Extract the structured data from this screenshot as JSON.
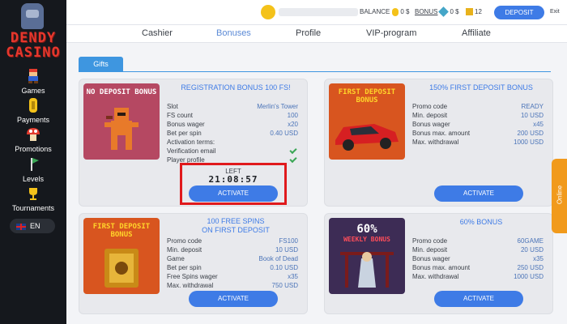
{
  "sidebar": {
    "logo_line1": "DENDY",
    "logo_line2": "CASINO",
    "items": [
      {
        "label": "Games"
      },
      {
        "label": "Payments"
      },
      {
        "label": "Promotions"
      },
      {
        "label": "Levels"
      },
      {
        "label": "Tournaments"
      }
    ],
    "language": "EN"
  },
  "header": {
    "balance_label": "BALANCE",
    "balance_value": "0",
    "balance_currency": "$",
    "bonus_label": "BONUS",
    "bonus_value": "0",
    "bonus_currency": "$",
    "gifts_count": "12",
    "deposit_label": "DEPOSIT",
    "exit_label": "Exit"
  },
  "tabs": [
    "Cashier",
    "Bonuses",
    "Profile",
    "VIP-program",
    "Affiliate"
  ],
  "active_tab": "Bonuses",
  "subtab": "Gifts",
  "cards": [
    {
      "image_label": "NO DEPOSIT BONUS",
      "title": "REGISTRATION BONUS 100 FS!",
      "rows": [
        {
          "k": "Slot",
          "v": "Merlin's Tower"
        },
        {
          "k": "FS count",
          "v": "100"
        },
        {
          "k": "Bonus wager",
          "v": "x20"
        },
        {
          "k": "Bet per spin",
          "v": "0.40 USD"
        },
        {
          "k": "Activation terms:",
          "v": ""
        },
        {
          "k": "Verification email",
          "v": ""
        },
        {
          "k": "Player profile",
          "v": ""
        }
      ],
      "timer_label": "LEFT",
      "timer_value": "21:08:57",
      "button": "ACTIVATE"
    },
    {
      "image_label": "FIRST DEPOSIT BONUS",
      "title": "150% FIRST DEPOSIT BONUS",
      "rows": [
        {
          "k": "Promo code",
          "v": "READY"
        },
        {
          "k": "Min. deposit",
          "v": "10 USD"
        },
        {
          "k": "Bonus wager",
          "v": "x45"
        },
        {
          "k": "Bonus max. amount",
          "v": "200 USD"
        },
        {
          "k": "Max. withdrawal",
          "v": "1000 USD"
        }
      ],
      "button": "ACTIVATE"
    },
    {
      "image_label": "FIRST DEPOSIT BONUS",
      "title_line1": "100 FREE SPINS",
      "title_line2": "ON FIRST DEPOSIT",
      "rows": [
        {
          "k": "Promo code",
          "v": "FS100"
        },
        {
          "k": "Min. deposit",
          "v": "10 USD"
        },
        {
          "k": "Game",
          "v": "Book of Dead"
        },
        {
          "k": "Bet per spin",
          "v": "0.10 USD"
        },
        {
          "k": "Free Spins wager",
          "v": "x35"
        },
        {
          "k": "Max. withdrawal",
          "v": "750 USD"
        }
      ],
      "button": "ACTIVATE"
    },
    {
      "image_label_1": "60%",
      "image_label_2": "WEEKLY BONUS",
      "title": "60% BONUS",
      "rows": [
        {
          "k": "Promo code",
          "v": "60GAME"
        },
        {
          "k": "Min. deposit",
          "v": "20 USD"
        },
        {
          "k": "Bonus wager",
          "v": "x35"
        },
        {
          "k": "Bonus max. amount",
          "v": "250 USD"
        },
        {
          "k": "Max. withdrawal",
          "v": "1000 USD"
        }
      ],
      "button": "ACTIVATE"
    }
  ],
  "online_label": "Online",
  "colors": {
    "accent": "#3e7be6",
    "sidebar": "#15181d",
    "highlight": "#e0191c",
    "online": "#f19a1c"
  }
}
